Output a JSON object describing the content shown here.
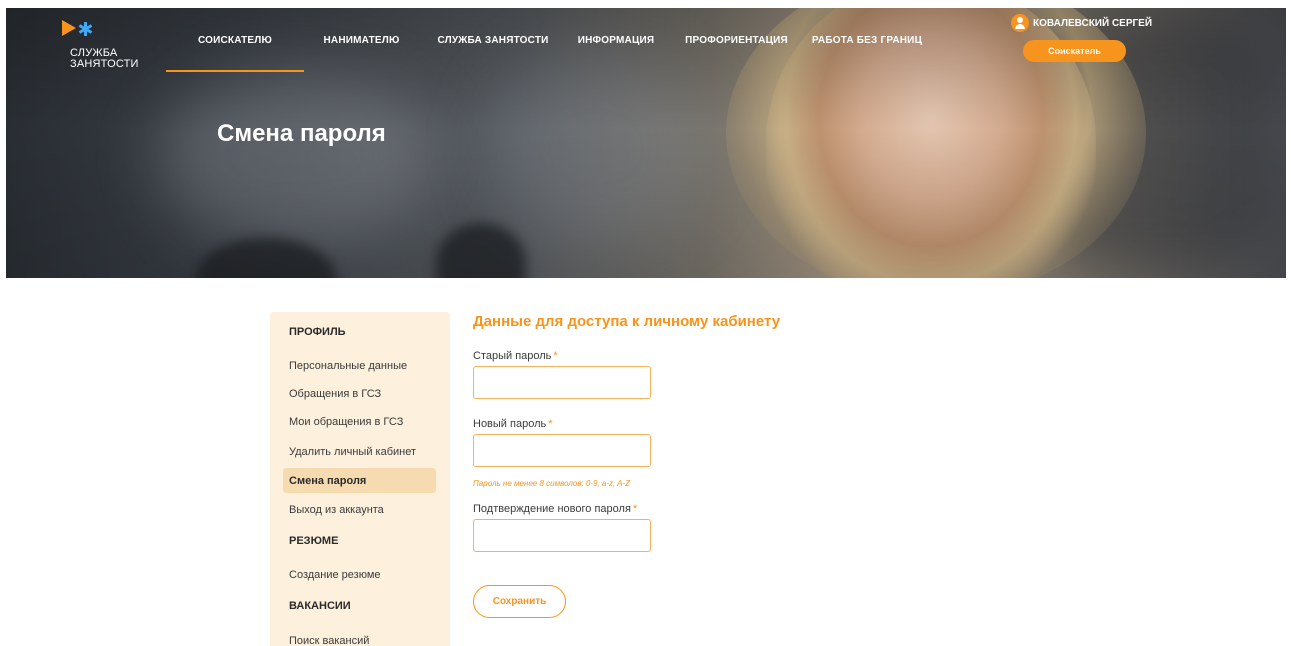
{
  "brand": {
    "logo_line1": "СЛУЖБА",
    "logo_line2": "ЗАНЯТОСТИ",
    "accent": "#f7941d",
    "accent_blue": "#3fa9f5"
  },
  "nav": {
    "items": [
      {
        "label": "СОИСКАТЕЛЮ",
        "active": true
      },
      {
        "label": "НАНИМАТЕЛЮ",
        "active": false
      },
      {
        "label": "СЛУЖБА ЗАНЯТОСТИ",
        "active": false
      },
      {
        "label": "ИНФОРМАЦИЯ",
        "active": false
      },
      {
        "label": "ПРОФОРИЕНТАЦИЯ",
        "active": false
      },
      {
        "label": "РАБОТА БЕЗ ГРАНИЦ",
        "active": false
      }
    ]
  },
  "user": {
    "name": "КОВАЛЕВСКИЙ СЕРГЕЙ",
    "role_button": "Соискатель",
    "avatar_icon": "user-avatar-icon"
  },
  "hero": {
    "title": "Смена пароля"
  },
  "sidebar": {
    "sections": [
      {
        "heading": "ПРОФИЛЬ",
        "items": [
          {
            "label": "Персональные данные",
            "active": false
          },
          {
            "label": "Обращения в ГСЗ",
            "active": false
          },
          {
            "label": "Мои обращения в ГСЗ",
            "active": false
          },
          {
            "label": "Удалить личный кабинет",
            "active": false
          },
          {
            "label": "Смена пароля",
            "active": true
          },
          {
            "label": "Выход из аккаунта",
            "active": false
          }
        ]
      },
      {
        "heading": "РЕЗЮМЕ",
        "items": [
          {
            "label": "Создание резюме",
            "active": false
          }
        ]
      },
      {
        "heading": "ВАКАНСИИ",
        "items": [
          {
            "label": "Поиск вакансий",
            "active": false
          }
        ]
      }
    ]
  },
  "form": {
    "title": "Данные для доступа к личному кабинету",
    "old_password": {
      "label": "Старый пароль",
      "required_mark": "*",
      "value": ""
    },
    "new_password": {
      "label": "Новый пароль",
      "required_mark": "*",
      "value": ""
    },
    "hint": "Пароль не менее 8 символов: 0-9, a-z, A-Z",
    "confirm_password": {
      "label": "Подтверждение нового пароля",
      "required_mark": "*",
      "value": ""
    },
    "save_label": "Сохранить"
  }
}
